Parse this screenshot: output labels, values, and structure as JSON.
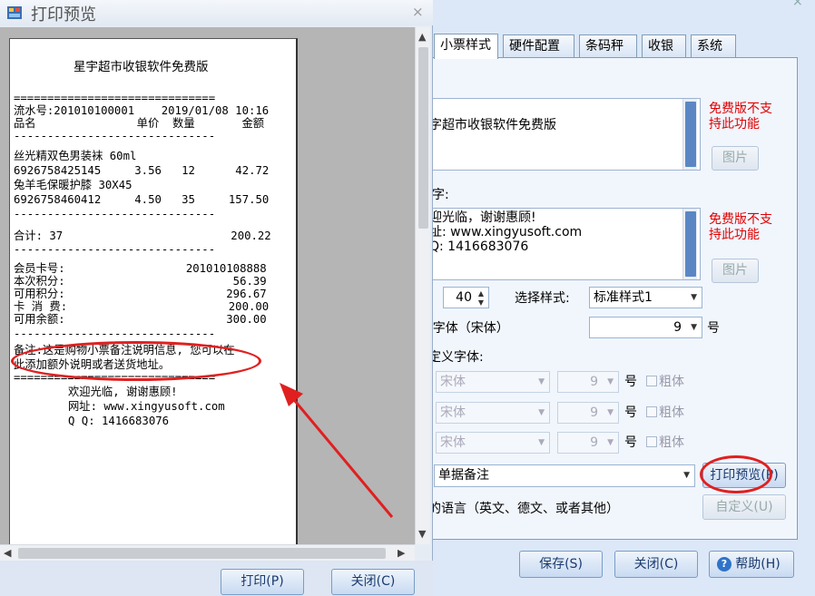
{
  "settings": {
    "tabs": [
      "小票样式",
      "硬件配置",
      "条码秤",
      "收银",
      "系统"
    ],
    "header_text": "字超市收银软件免费版",
    "free_note": "免费版不支\n持此功能",
    "picture_button": "图片",
    "footer_label": "字:",
    "footer_text": "迎光临，谢谢惠顾!\n址: www.xingyusoft.com\nQ: 1416683076",
    "width_value": "40",
    "style_label": "选择样式:",
    "style_value": "标准样式1",
    "font_label": "\\字体（宋体）",
    "font_size": "9",
    "unit": "号",
    "custom_font_label": "定义字体:",
    "custom_fonts": [
      {
        "font": "宋体",
        "size": "9",
        "bold": "粗体"
      },
      {
        "font": "宋体",
        "size": "9",
        "bold": "粗体"
      },
      {
        "font": "宋体",
        "size": "9",
        "bold": "粗体"
      }
    ],
    "remark_value": "单据备注",
    "print_preview_button": "打印预览(P)",
    "language_label": "的语言（英文、德文、或者其他）",
    "custom_button": "自定义(U)",
    "save_button": "保存(S)",
    "close_button": "关闭(C)",
    "help_button": "帮助(H)"
  },
  "preview": {
    "title": "打印预览",
    "receipt": {
      "title": "星宇超市收银软件免费版",
      "sep_double": "==============================",
      "sep_single": "------------------------------",
      "serial_line": "流水号:201010100001    2019/01/08 10:16",
      "header_line": "品名               单价  数量       金额",
      "items": [
        "丝光精双色男装袜 60ml",
        "6926758425145     3.56   12      42.72",
        "兔羊毛保暖护膝 30X45",
        "6926758460412     4.50   35     157.50"
      ],
      "total_line": "合计: 37                         200.22",
      "member": [
        "会员卡号:                  201010108888",
        "本次积分:                         56.39",
        "可用积分:                        296.67",
        "卡 消 费:                        200.00",
        "可用余额:                        300.00"
      ],
      "remark": [
        "备注:这是购物小票备注说明信息, 您可以在",
        "此添加额外说明或者送货地址。"
      ],
      "footer": [
        "欢迎光临, 谢谢惠顾!",
        "网址: www.xingyusoft.com",
        "Q Q: 1416683076"
      ]
    },
    "print_button": "打印(P)",
    "close_button": "关闭(C)"
  },
  "colors": {
    "annotation": "#e02020",
    "accent": "#5a87c4"
  }
}
